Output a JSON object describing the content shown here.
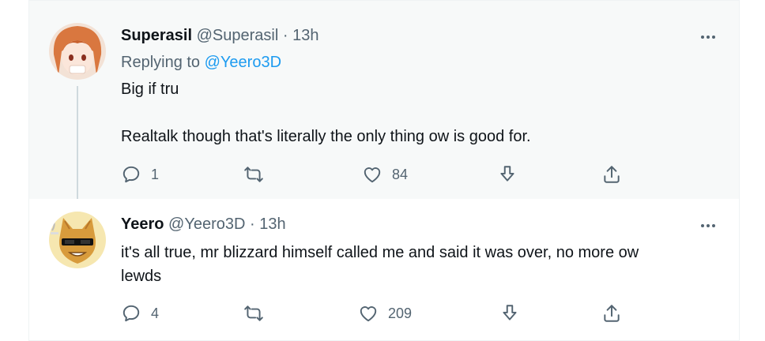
{
  "tweets": [
    {
      "name": "Superasil",
      "handle": "@Superasil",
      "separator": "·",
      "time": "13h",
      "replying_prefix": "Replying to",
      "replying_to": "@Yeero3D",
      "lines": [
        "Big if tru",
        "Realtalk though that's literally the only thing ow is good for."
      ],
      "reply_count": "1",
      "like_count": "84"
    },
    {
      "name": "Yeero",
      "handle": "@Yeero3D",
      "separator": "·",
      "time": "13h",
      "lines": [
        "it's all true, mr blizzard himself called me and said it was over, no more ow",
        "lewds"
      ],
      "reply_count": "4",
      "like_count": "209"
    }
  ],
  "icons": [
    "reply-icon",
    "retweet-icon",
    "like-icon",
    "download-icon",
    "share-icon",
    "more-icon"
  ],
  "colors": {
    "accent": "#1d9bf0",
    "muted": "#536471",
    "text": "#0f1419",
    "highlight_bg": "#f7f9f9"
  }
}
